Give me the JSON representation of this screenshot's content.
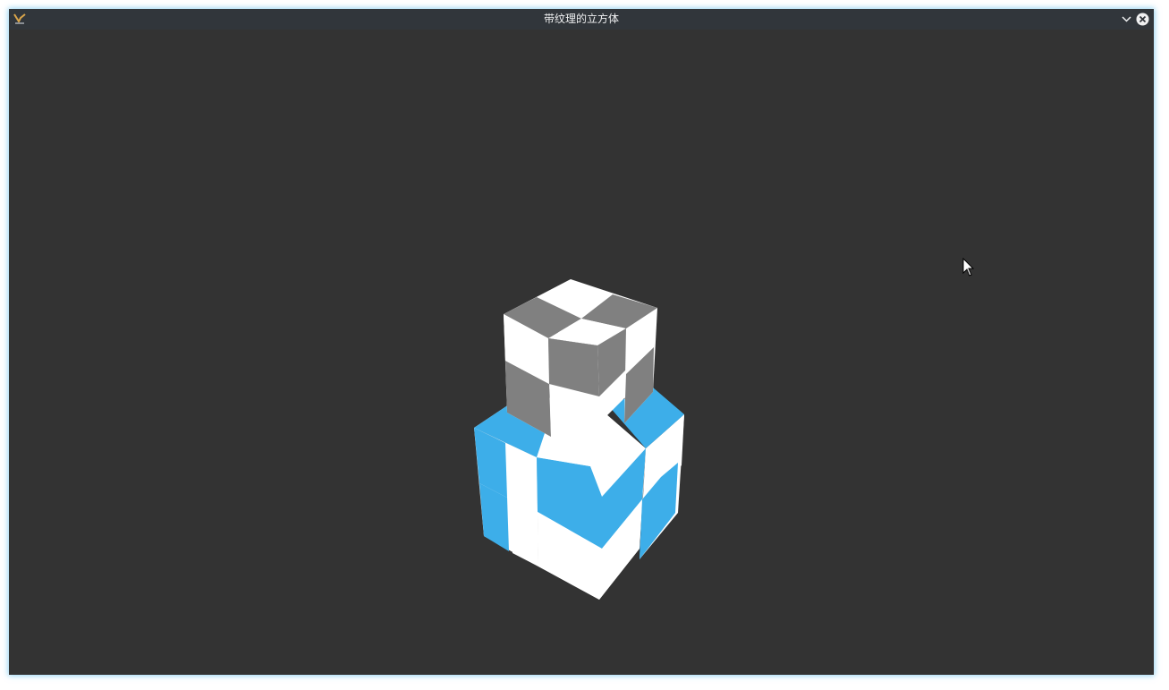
{
  "window": {
    "title": "带纹理的立方体",
    "app_icon": "kde-app-icon",
    "buttons": [
      {
        "name": "minimize-button",
        "icon": "chevron-down-icon"
      },
      {
        "name": "close-button",
        "icon": "close-circle-icon"
      }
    ]
  },
  "scene": {
    "description_objects": [
      "textured-cube-gray",
      "textured-cube-blue"
    ],
    "colors": {
      "background": "#333333",
      "checker_white": "#ffffff",
      "checker_gray": "#808080",
      "checker_blue": "#3daee9",
      "titlebar": "#31363b"
    }
  }
}
